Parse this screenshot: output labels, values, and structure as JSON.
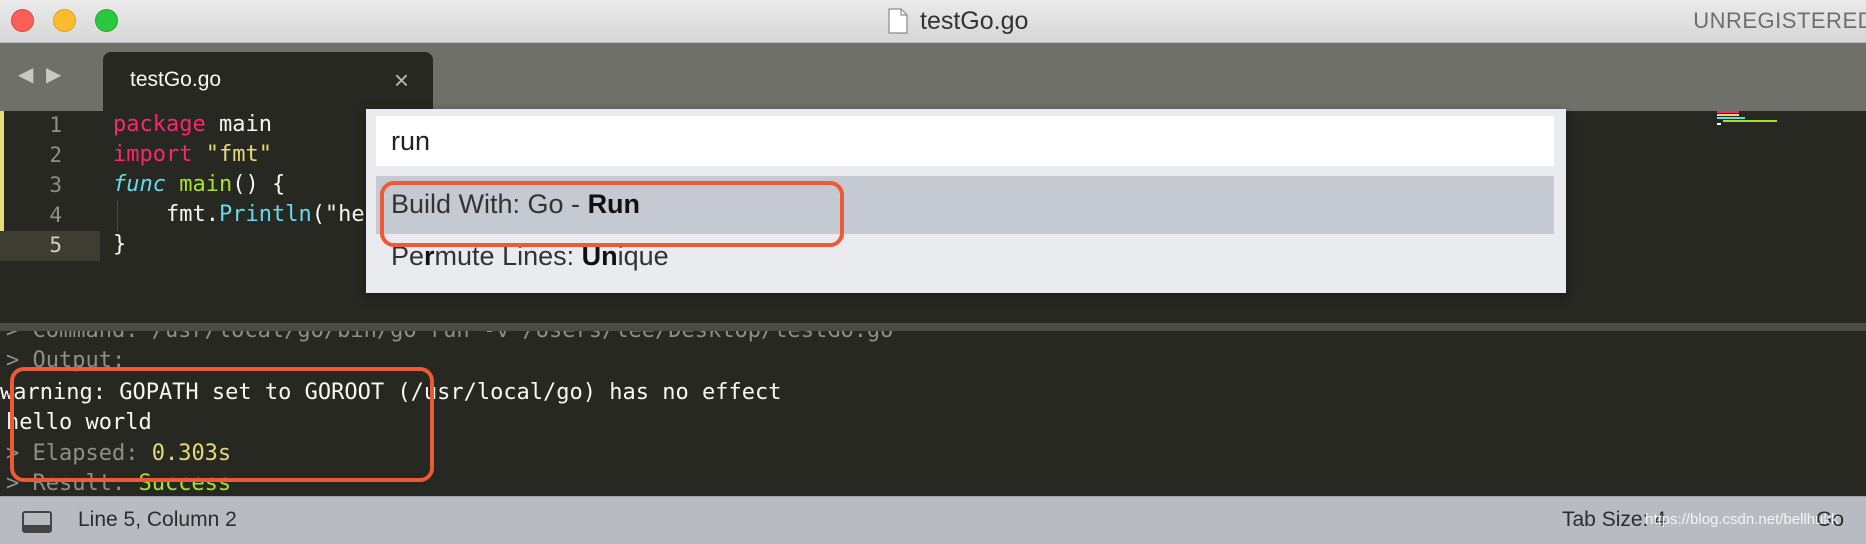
{
  "window": {
    "title": "testGo.go",
    "unregistered": "UNREGISTERED"
  },
  "tabs": [
    {
      "label": "testGo.go",
      "close": "×"
    }
  ],
  "editor": {
    "lines": [
      {
        "number": "1",
        "tokens": [
          {
            "t": "package",
            "c": "kw"
          },
          {
            "t": " main",
            "c": ""
          }
        ]
      },
      {
        "number": "2",
        "tokens": [
          {
            "t": "import",
            "c": "kw"
          },
          {
            "t": " ",
            "c": ""
          },
          {
            "t": "\"fmt\"",
            "c": "str"
          }
        ]
      },
      {
        "number": "3",
        "tokens": [
          {
            "t": "func",
            "c": "fn-kw"
          },
          {
            "t": " ",
            "c": ""
          },
          {
            "t": "main",
            "c": "fn"
          },
          {
            "t": "() {",
            "c": ""
          }
        ]
      },
      {
        "number": "4",
        "tokens": [
          {
            "t": "    fmt.",
            "c": ""
          },
          {
            "t": "Println",
            "c": "call"
          },
          {
            "t": "(\"he",
            "c": ""
          }
        ]
      },
      {
        "number": "5",
        "tokens": [
          {
            "t": "}",
            "c": ""
          }
        ]
      }
    ],
    "current_line": 5
  },
  "command_palette": {
    "query": "run",
    "items": [
      {
        "plain": "Build With: Go - ",
        "bold": "Run",
        "selected": true
      },
      {
        "parts": [
          {
            "t": "Pe",
            "b": false
          },
          {
            "t": "r",
            "b": true
          },
          {
            "t": "mute Lines: ",
            "b": false
          },
          {
            "t": "Un",
            "b": true
          },
          {
            "t": "ique",
            "b": false
          }
        ]
      }
    ]
  },
  "output": {
    "lines": [
      {
        "segments": [
          {
            "t": "> Command: /usr/local/go/bin/go run -v /Users/lee/Desktop/testGo.go",
            "c": "dim"
          }
        ]
      },
      {
        "segments": [
          {
            "t": "> Output:",
            "c": "dim"
          }
        ]
      },
      {
        "segments": [
          {
            "t": "warning: GOPATH set to GOROOT (/usr/local/go) has no effect",
            "c": "white"
          }
        ]
      },
      {
        "segments": [
          {
            "t": "hello world",
            "c": "white"
          }
        ]
      },
      {
        "segments": [
          {
            "t": "> Elapsed: ",
            "c": "dim"
          },
          {
            "t": "0.303s",
            "c": "yellow"
          }
        ]
      },
      {
        "segments": [
          {
            "t": "> Result: ",
            "c": "dim"
          },
          {
            "t": "Success",
            "c": "green"
          }
        ]
      }
    ]
  },
  "statusbar": {
    "position": "Line 5, Column 2",
    "tab_size": "Tab Size: 4",
    "syntax": "Go"
  },
  "watermark": "https://blog.csdn.net/bellhukk",
  "colors": {
    "background": "#272822",
    "keyword": "#f92672",
    "string": "#e6db74",
    "function": "#a6e22e",
    "annotation": "#ed5a35"
  }
}
